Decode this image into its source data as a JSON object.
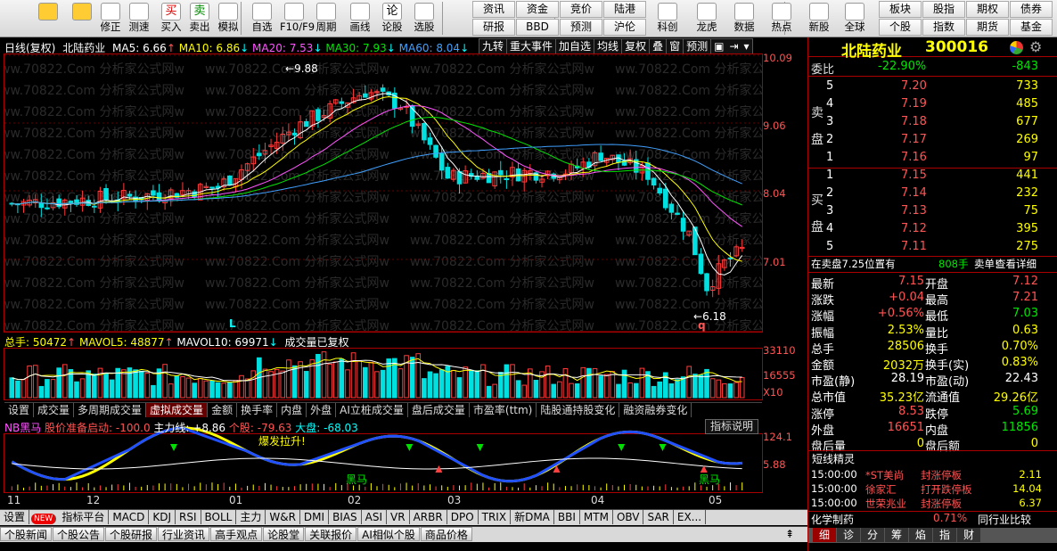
{
  "toolbar": {
    "left": [
      {
        "icon": "back-arrow-icon",
        "label": ""
      },
      {
        "icon": "up-down-icon",
        "label": ""
      },
      {
        "icon": "repair-icon",
        "label": "修正"
      },
      {
        "icon": "clock-icon",
        "label": "测速"
      },
      {
        "icon": "buy-icon",
        "label": "买入",
        "glyph": "买"
      },
      {
        "icon": "sell-icon",
        "label": "卖出",
        "glyph": "卖"
      },
      {
        "icon": "hammer-icon",
        "label": "模拟"
      },
      {
        "icon": "select-icon",
        "label": "自选"
      },
      {
        "icon": "f10-icon",
        "label": "F10/F9"
      },
      {
        "icon": "cycle-icon",
        "label": "周期"
      },
      {
        "icon": "draw-icon",
        "label": "画线"
      },
      {
        "icon": "argue-icon",
        "label": "论股",
        "glyph": "论"
      },
      {
        "icon": "pick-icon",
        "label": "选股"
      }
    ],
    "grid1": [
      "资讯",
      "资金",
      "竞价",
      "陆港"
    ],
    "grid2": [
      "研报",
      "BBD",
      "预测",
      "沪伦"
    ],
    "right": [
      {
        "icon": "kline-icon",
        "label": "科创"
      },
      {
        "icon": "dragon-icon",
        "label": "龙虎"
      },
      {
        "icon": "pe-icon",
        "label": "数据"
      },
      {
        "icon": "hot-icon",
        "label": "热点"
      },
      {
        "icon": "ipo-icon",
        "label": "新股"
      },
      {
        "icon": "globe-icon",
        "label": "全球"
      }
    ],
    "grid3": [
      "板块",
      "股指",
      "期权",
      "债券"
    ],
    "grid4": [
      "个股",
      "指数",
      "期货",
      "基金"
    ]
  },
  "chart_header": {
    "name": "日线(复权)",
    "stock": "北陆药业",
    "ma5": "MA5: 6.66",
    "ma10": "MA10: 6.86",
    "ma20": "MA20: 7.53",
    "ma30": "MA30: 7.93",
    "ma60": "MA60: 8.04"
  },
  "chart_buttons": [
    "九转",
    "重大事件",
    "加自选",
    "均线",
    "复权",
    "叠",
    "窗",
    "预测"
  ],
  "price_axis": [
    "10.09",
    "9.06",
    "8.04",
    "7.01"
  ],
  "annotations": {
    "high": "9.88",
    "low": "6.18",
    "mark_l": "L",
    "mark_q": "q"
  },
  "vol_header": {
    "total": "总手: 50472",
    "mavol5": "MAVOL5: 48877",
    "mavol10": "MAVOL10: 69971",
    "note": "成交量已复权"
  },
  "vol_axis": [
    "33110",
    "16555",
    "X10"
  ],
  "ind_tabs": [
    "设置",
    "成交量",
    "多周期成交量",
    "虚拟成交量",
    "金额",
    "换手率",
    "内盘",
    "外盘",
    "AI立桩成交量",
    "盘后成交量",
    "市盈率(ttm)",
    "陆股通持股变化",
    "融资融券变化"
  ],
  "ind_header": {
    "nb": "NB黑马",
    "a1": "股价准备启动: -100.0",
    "a2": "主力线: +8.86",
    "a3": "个股: -79.63",
    "a4": "大盘: -68.03",
    "desc": "指标说明"
  },
  "ind_axis": [
    "124.1",
    "5.88"
  ],
  "ind_labels": {
    "burst": "爆发拉升!",
    "hm1": "黑马",
    "hm2": "黑马"
  },
  "dates": [
    "11",
    "12",
    "01",
    "02",
    "03",
    "04",
    "05"
  ],
  "bottom_tabs": [
    "设置",
    "NEW",
    "指标平台",
    "MACD",
    "KDJ",
    "RSI",
    "BOLL",
    "主力",
    "W&R",
    "DMI",
    "BIAS",
    "ASI",
    "VR",
    "ARBR",
    "DPO",
    "TRIX",
    "新DMA",
    "BBI",
    "MTM",
    "OBV",
    "SAR",
    "EX..."
  ],
  "bottom_tabs2": [
    "个股新闻",
    "个股公告",
    "个股研报",
    "行业资讯",
    "高手观点",
    "论股堂",
    "关联报价",
    "AI相似个股",
    "商品价格"
  ],
  "quote": {
    "title": "北陆药业",
    "code": "300016",
    "weibi_label": "委比",
    "weibi": "-22.90%",
    "weicha": "-843",
    "sell_label": [
      "卖",
      "盘"
    ],
    "buy_label": [
      "买",
      "盘"
    ],
    "sell": [
      {
        "lvl": "5",
        "p": "7.20",
        "v": "733"
      },
      {
        "lvl": "4",
        "p": "7.19",
        "v": "485"
      },
      {
        "lvl": "3",
        "p": "7.18",
        "v": "677"
      },
      {
        "lvl": "2",
        "p": "7.17",
        "v": "269"
      },
      {
        "lvl": "1",
        "p": "7.16",
        "v": "97"
      }
    ],
    "buy": [
      {
        "lvl": "1",
        "p": "7.15",
        "v": "441"
      },
      {
        "lvl": "2",
        "p": "7.14",
        "v": "232"
      },
      {
        "lvl": "3",
        "p": "7.13",
        "v": "75"
      },
      {
        "lvl": "4",
        "p": "7.12",
        "v": "395"
      },
      {
        "lvl": "5",
        "p": "7.11",
        "v": "275"
      }
    ],
    "order_line": {
      "a": "在卖盘7.25位置有",
      "b": "808手",
      "c": "卖单!",
      "d": "查看详细"
    },
    "stats": [
      {
        "l1": "最新",
        "v1": "7.15",
        "c1": "red",
        "l2": "开盘",
        "v2": "7.12",
        "c2": "red"
      },
      {
        "l1": "涨跌",
        "v1": "+0.04",
        "c1": "red",
        "l2": "最高",
        "v2": "7.21",
        "c2": "red"
      },
      {
        "l1": "涨幅",
        "v1": "+0.56%",
        "c1": "red",
        "l2": "最低",
        "v2": "7.03",
        "c2": "grn"
      },
      {
        "l1": "振幅",
        "v1": "2.53%",
        "c1": "yel",
        "l2": "量比",
        "v2": "0.63",
        "c2": "yel"
      },
      {
        "l1": "总手",
        "v1": "28506",
        "c1": "yel",
        "l2": "换手",
        "v2": "0.70%",
        "c2": "yel"
      },
      {
        "l1": "金额",
        "v1": "2032万",
        "c1": "yel",
        "l2": "换手(实)",
        "v2": "0.83%",
        "c2": "yel"
      },
      {
        "l1": "市盈(静)",
        "v1": "28.19",
        "c1": "wh",
        "l2": "市盈(动)",
        "v2": "22.43",
        "c2": "wh"
      },
      {
        "l1": "总市值",
        "v1": "35.23亿",
        "c1": "yel",
        "l2": "流通值",
        "v2": "29.26亿",
        "c2": "yel"
      },
      {
        "l1": "涨停",
        "v1": "8.53",
        "c1": "red",
        "l2": "跌停",
        "v2": "5.69",
        "c2": "grn"
      },
      {
        "l1": "外盘",
        "v1": "16651",
        "c1": "red",
        "l2": "内盘",
        "v2": "11856",
        "c2": "grn"
      },
      {
        "l1": "盘后量",
        "v1": "0",
        "c1": "yel",
        "l2": "盘后额",
        "v2": "0",
        "c2": "yel"
      }
    ],
    "news_title": "短线精灵",
    "news": [
      {
        "t": "15:00:00",
        "s": "*ST美尚",
        "e": "封涨停板",
        "v": "2.11"
      },
      {
        "t": "15:00:00",
        "s": "徐家汇",
        "e": "打开跌停板",
        "v": "14.04"
      },
      {
        "t": "15:00:00",
        "s": "世荣兆业",
        "e": "封涨停板",
        "v": "6.37"
      }
    ],
    "sector": {
      "name": "化学制药",
      "chg": "0.71%",
      "cmp": "同行业比较"
    },
    "tabs": [
      "细",
      "诊",
      "分",
      "筹",
      "焰",
      "指",
      "财"
    ]
  },
  "colors": {
    "up": "#ff3c3c",
    "down": "#00e0e0",
    "ma5": "#ffffff",
    "ma10": "#ffff00",
    "ma20": "#ff55ff",
    "ma30": "#00e600",
    "ma60": "#40a0ff"
  }
}
